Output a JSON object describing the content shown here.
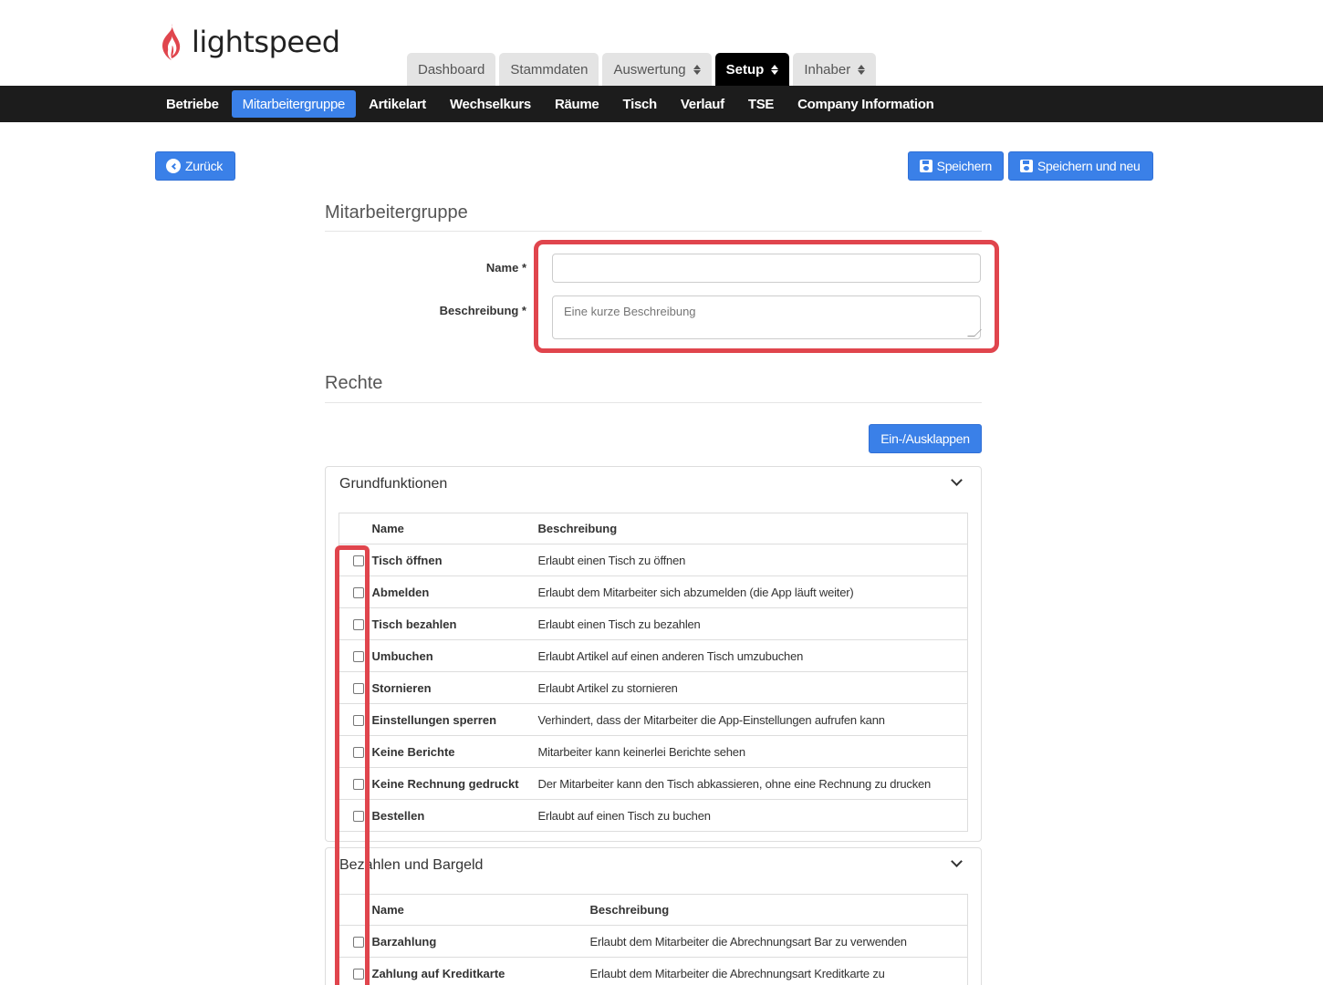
{
  "logo": {
    "text": "lightspeed",
    "color": "#e0454d"
  },
  "top_tabs": [
    {
      "label": "Dashboard",
      "active": false,
      "dropdown": false
    },
    {
      "label": "Stammdaten",
      "active": false,
      "dropdown": false
    },
    {
      "label": "Auswertung",
      "active": false,
      "dropdown": true
    },
    {
      "label": "Setup",
      "active": true,
      "dropdown": true
    },
    {
      "label": "Inhaber",
      "active": false,
      "dropdown": true
    }
  ],
  "subnav": [
    {
      "label": "Betriebe",
      "active": false
    },
    {
      "label": "Mitarbeitergruppe",
      "active": true
    },
    {
      "label": "Artikelart",
      "active": false
    },
    {
      "label": "Wechselkurs",
      "active": false
    },
    {
      "label": "Räume",
      "active": false
    },
    {
      "label": "Tisch",
      "active": false
    },
    {
      "label": "Verlauf",
      "active": false
    },
    {
      "label": "TSE",
      "active": false
    },
    {
      "label": "Company Information",
      "active": false
    }
  ],
  "buttons": {
    "back": "Zurück",
    "save": "Speichern",
    "save_new": "Speichern und neu",
    "toggle": "Ein-/Ausklappen"
  },
  "form": {
    "title": "Mitarbeitergruppe",
    "name_label": "Name *",
    "name_value": "",
    "desc_label": "Beschreibung *",
    "desc_placeholder": "Eine kurze Beschreibung"
  },
  "rights": {
    "title": "Rechte",
    "col_name": "Name",
    "col_desc": "Beschreibung",
    "groups": [
      {
        "title": "Grundfunktionen",
        "rows": [
          {
            "name": "Tisch öffnen",
            "desc": "Erlaubt einen Tisch zu öffnen"
          },
          {
            "name": "Abmelden",
            "desc": "Erlaubt dem Mitarbeiter sich abzumelden (die App läuft weiter)"
          },
          {
            "name": "Tisch bezahlen",
            "desc": "Erlaubt einen Tisch zu bezahlen"
          },
          {
            "name": "Umbuchen",
            "desc": "Erlaubt Artikel auf einen anderen Tisch umzubuchen"
          },
          {
            "name": "Stornieren",
            "desc": "Erlaubt Artikel zu stornieren"
          },
          {
            "name": "Einstellungen sperren",
            "desc": "Verhindert, dass der Mitarbeiter die App-Einstellungen aufrufen kann"
          },
          {
            "name": "Keine Berichte",
            "desc": "Mitarbeiter kann keinerlei Berichte sehen"
          },
          {
            "name": "Keine Rechnung gedruckt",
            "desc": "Der Mitarbeiter kann den Tisch abkassieren, ohne eine Rechnung zu drucken"
          },
          {
            "name": "Bestellen",
            "desc": "Erlaubt auf einen Tisch zu buchen"
          }
        ]
      },
      {
        "title": "Bezahlen und Bargeld",
        "rows": [
          {
            "name": "Barzahlung",
            "desc": "Erlaubt dem Mitarbeiter die Abrechnungsart Bar zu verwenden"
          },
          {
            "name": "Zahlung auf Kreditkarte",
            "desc": "Erlaubt dem Mitarbeiter die Abrechnungsart Kreditkarte zu"
          }
        ]
      }
    ]
  },
  "colors": {
    "accent": "#3a80e8",
    "highlight": "#e0454d",
    "nav_bg": "#1c1c1c"
  }
}
